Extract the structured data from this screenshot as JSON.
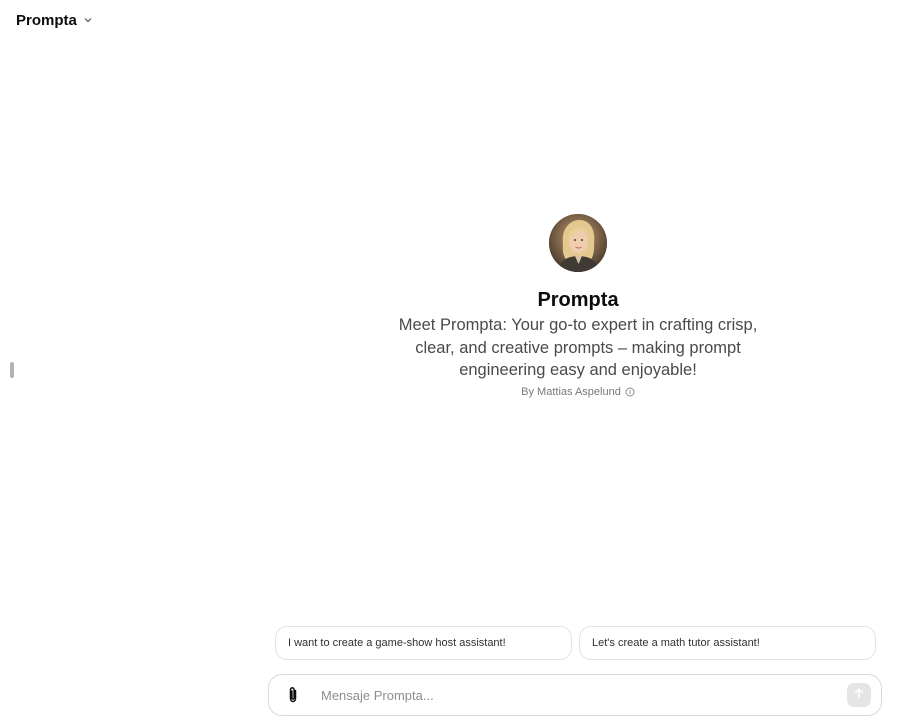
{
  "header": {
    "model_name": "Prompta",
    "chevron_icon": "chevron-down-icon"
  },
  "gpt": {
    "avatar_icon": "avatar-portrait",
    "name": "Prompta",
    "description": "Meet Prompta: Your go-to expert in crafting crisp, clear, and creative prompts – making prompt engineering easy and enjoyable!",
    "author": "By Mattias Aspelund",
    "author_info_icon": "info-icon"
  },
  "starters": [
    {
      "label": "I want to create a game-show host assistant!"
    },
    {
      "label": "Let's create a math tutor assistant!"
    }
  ],
  "composer": {
    "placeholder": "Mensaje Prompta...",
    "value": "",
    "attach_icon": "paperclip-icon",
    "send_icon": "arrow-up-icon"
  }
}
